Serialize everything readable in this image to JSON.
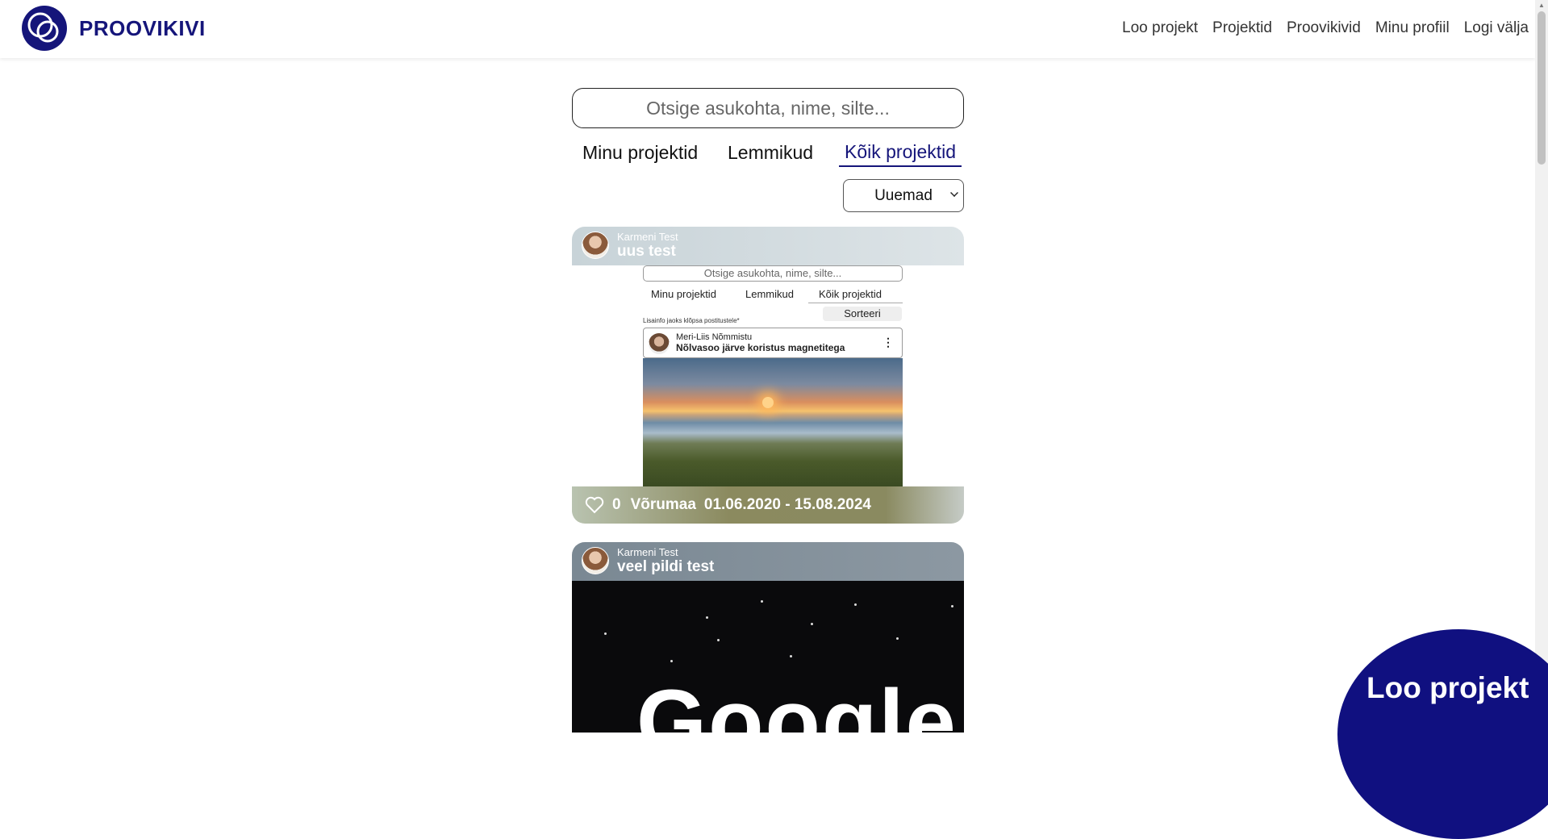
{
  "brand": "PROOVIKIVI",
  "nav": [
    "Loo projekt",
    "Projektid",
    "Proovikivid",
    "Minu profiil",
    "Logi välja"
  ],
  "search": {
    "placeholder": "Otsige asukohta, nime, silte..."
  },
  "tabs": [
    {
      "label": "Minu projektid",
      "active": false
    },
    {
      "label": "Lemmikud",
      "active": false
    },
    {
      "label": "Kõik projektid",
      "active": true
    }
  ],
  "sort": {
    "selected": "Uuemad"
  },
  "cards": [
    {
      "author": "Karmeni Test",
      "title": "uus test",
      "likes": "0",
      "location": "Võrumaa",
      "dates": "01.06.2020 - 15.08.2024",
      "image": {
        "search_placeholder": "Otsige asukohta, nime, silte...",
        "tabs": [
          "Minu projektid",
          "Lemmikud",
          "Kõik projektid"
        ],
        "sort_label": "Sorteeri",
        "hint": "Lisainfo jaoks klõpsa postitustele*",
        "author": "Meri-Liis Nõmmistu",
        "title": "Nõlvasoo järve koristus magnetitega"
      }
    },
    {
      "author": "Karmeni Test",
      "title": "veel pildi test",
      "image": {
        "text": "Google"
      }
    }
  ],
  "fab": {
    "label": "Loo projekt"
  },
  "colors": {
    "brand": "#15157a",
    "fab": "#101080"
  }
}
